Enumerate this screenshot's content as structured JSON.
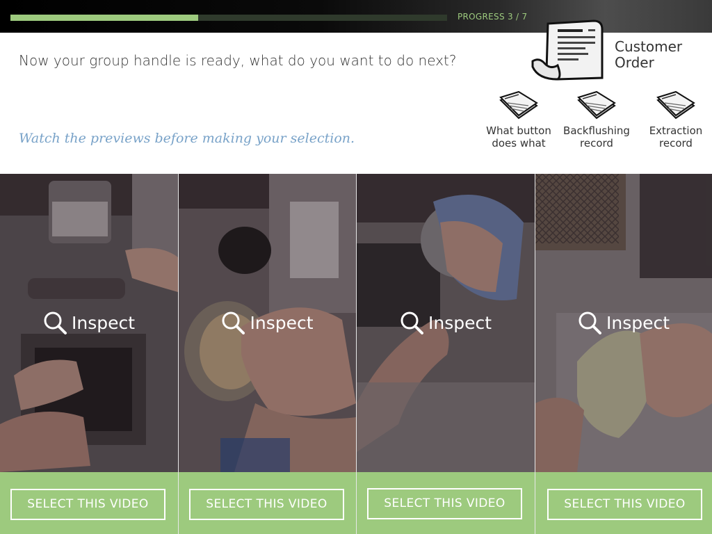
{
  "progress": {
    "label": "PROGRESS 3 / 7",
    "current": 3,
    "total": 7,
    "fill_fraction": 0.43
  },
  "question": "Now your group handle is ready, what do you want to do next?",
  "hint": "Watch the previews before making your selection.",
  "customer_order": {
    "label": "Customer Order",
    "icon": "receipt-icon"
  },
  "resources": [
    {
      "label": "What button does what",
      "icon": "backflush-card-icon"
    },
    {
      "label": "Backflushing record",
      "icon": "backflush-card-icon"
    },
    {
      "label": "Extraction record",
      "icon": "backflush-card-icon"
    }
  ],
  "videos": [
    {
      "inspect_label": "Inspect",
      "select_label": "SELECT THIS VIDEO"
    },
    {
      "inspect_label": "Inspect",
      "select_label": "SELECT THIS VIDEO"
    },
    {
      "inspect_label": "Inspect",
      "select_label": "SELECT THIS VIDEO"
    },
    {
      "inspect_label": "Inspect",
      "select_label": "SELECT THIS VIDEO"
    }
  ],
  "colors": {
    "accent_green": "#9dca7e",
    "hint_blue": "#78a2c8",
    "text_dark": "#333333"
  }
}
